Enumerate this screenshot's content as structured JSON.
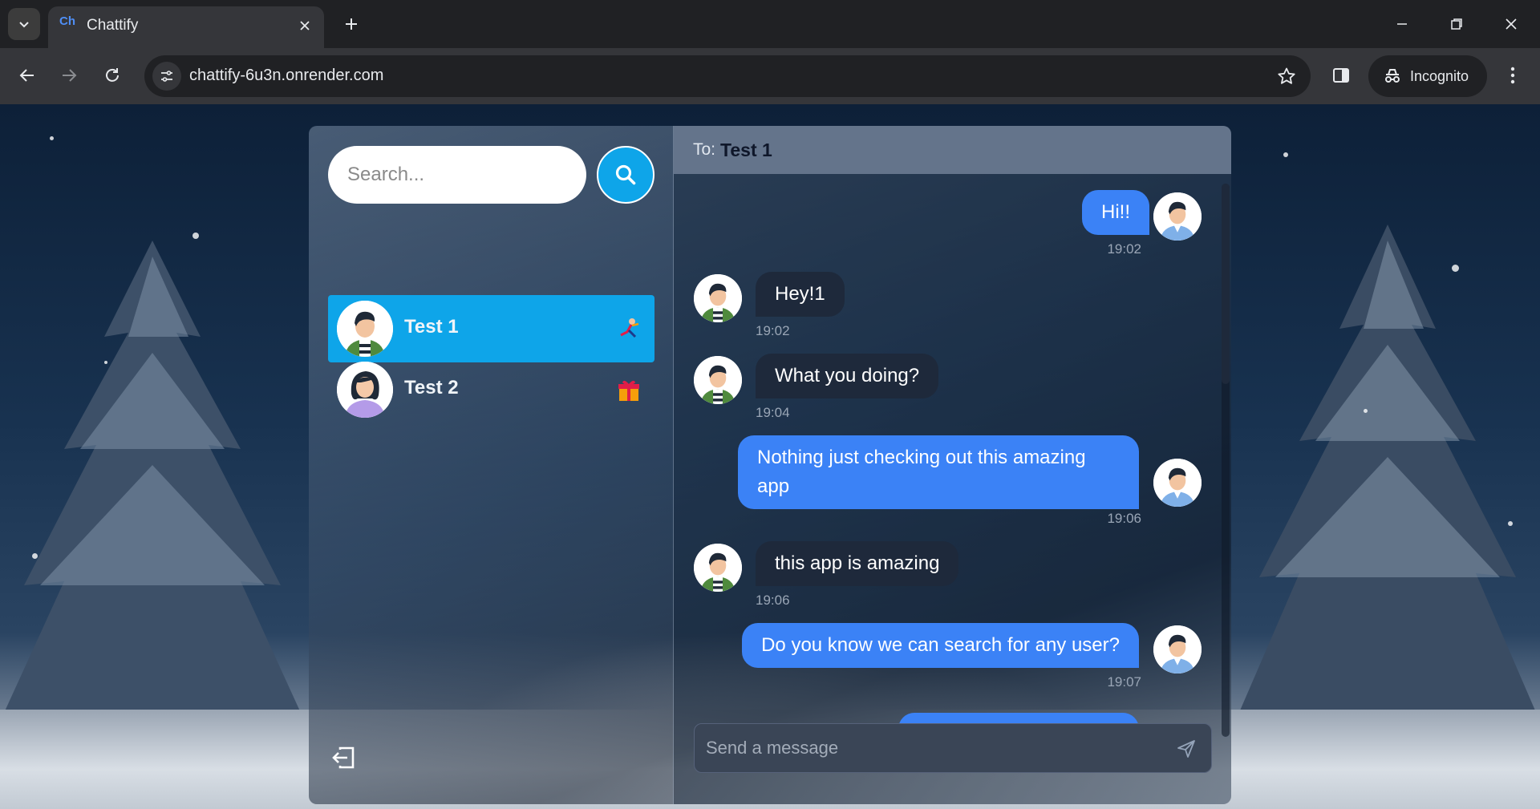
{
  "browser": {
    "tab_title": "Chattify",
    "tab_favicon_text": "Ch",
    "url": "chattify-6u3n.onrender.com",
    "incognito_label": "Incognito"
  },
  "sidebar": {
    "search_placeholder": "Search...",
    "conversations": [
      {
        "name": "Test 1",
        "emoji": "juggler-icon",
        "active": true
      },
      {
        "name": "Test 2",
        "emoji": "gift-icon",
        "active": false
      }
    ]
  },
  "chat": {
    "to_label": "To:",
    "to_name": "Test 1",
    "messages": [
      {
        "direction": "out",
        "text": "Hi!!",
        "time": "19:02"
      },
      {
        "direction": "in",
        "text": "Hey!1",
        "time": "19:02"
      },
      {
        "direction": "in",
        "text": "What you doing?",
        "time": "19:04"
      },
      {
        "direction": "out",
        "text": "Nothing just checking out this amazing app",
        "time": "19:06"
      },
      {
        "direction": "in",
        "text": "this app is amazing",
        "time": "19:06"
      },
      {
        "direction": "out",
        "text": "Do you know we can search for any user?",
        "time": "19:07"
      }
    ],
    "composer_placeholder": "Send a message"
  },
  "colors": {
    "accent": "#0ea5e9",
    "outgoing_bubble": "#3b82f6",
    "incoming_bubble": "#1e293b",
    "header": "#64748b"
  }
}
